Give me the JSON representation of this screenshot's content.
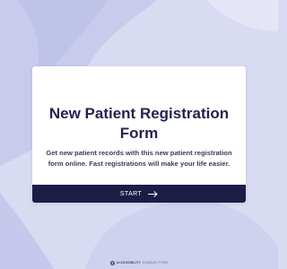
{
  "form": {
    "title": "New Patient Registration Form",
    "description": "Get new patient records with this new patient registration form online. Fast registrations will make your life easier.",
    "start_label": "START",
    "start_icon": "arrow-right-icon"
  },
  "footer": {
    "brand_strong": "ACCESSIBILITY",
    "brand_rest": " ENABLED FORM",
    "icon": "accessibility-icon"
  },
  "colors": {
    "background": "#d9dbf2",
    "button": "#1d1c45",
    "title": "#232350"
  }
}
